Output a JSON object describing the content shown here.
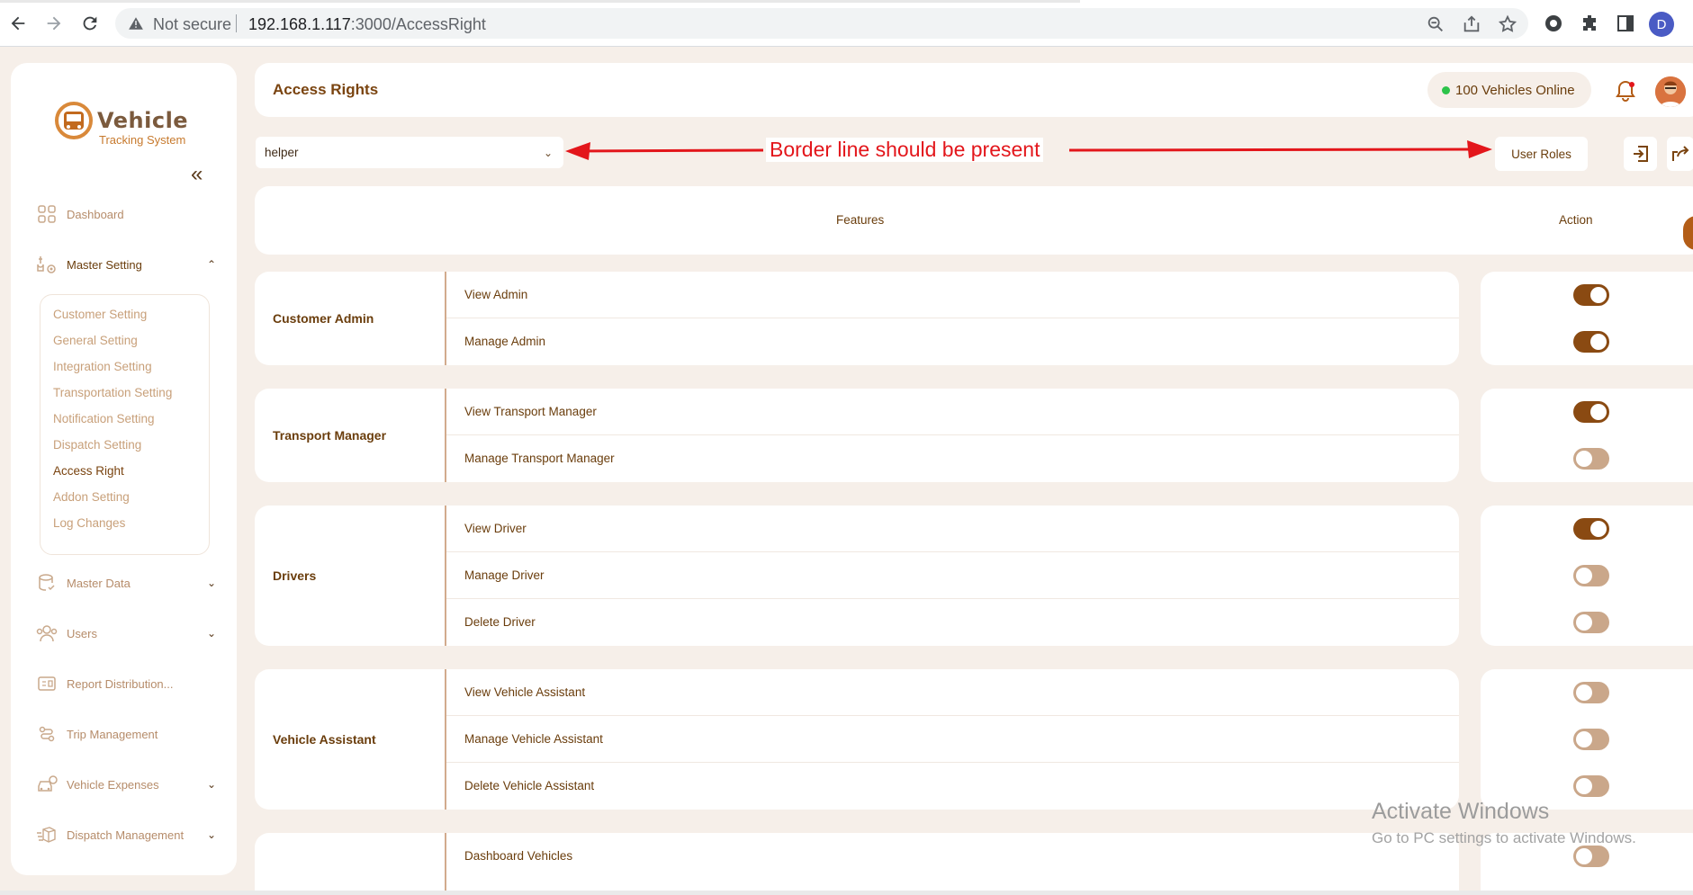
{
  "browser": {
    "security_label": "Not secure",
    "url_host": "192.168.1.117",
    "url_path": ":3000/AccessRight",
    "profile_initial": "D"
  },
  "sidebar": {
    "logo_title": "Vehicle",
    "logo_subtitle": "Tracking System",
    "items": [
      {
        "label": "Dashboard",
        "icon": "dashboard-icon"
      },
      {
        "label": "Master Setting",
        "icon": "settings-icon"
      },
      {
        "label": "Master Data",
        "icon": "database-icon"
      },
      {
        "label": "Users",
        "icon": "users-icon"
      },
      {
        "label": "Report Distribution...",
        "icon": "report-icon"
      },
      {
        "label": "Trip Management",
        "icon": "route-icon"
      },
      {
        "label": "Vehicle Expenses",
        "icon": "car-expense-icon"
      },
      {
        "label": "Dispatch Management",
        "icon": "dispatch-icon"
      }
    ],
    "submenu": [
      "Customer Setting",
      "General Setting",
      "Integration Setting",
      "Transportation Setting",
      "Notification Setting",
      "Dispatch Setting",
      "Access Right",
      "Addon Setting",
      "Log Changes"
    ],
    "active_submenu": "Access Right"
  },
  "header": {
    "title": "Access Rights",
    "online_label": "100 Vehicles Online"
  },
  "toolbar": {
    "role_value": "helper",
    "annotation": "Border line should be present",
    "user_roles_label": "User Roles"
  },
  "table": {
    "col_features": "Features",
    "col_action": "Action",
    "groups": [
      {
        "name": "Customer Admin",
        "features": [
          {
            "label": "View Admin",
            "enabled": true
          },
          {
            "label": "Manage Admin",
            "enabled": true
          }
        ]
      },
      {
        "name": "Transport Manager",
        "features": [
          {
            "label": "View Transport Manager",
            "enabled": true
          },
          {
            "label": "Manage Transport Manager",
            "enabled": false
          }
        ]
      },
      {
        "name": "Drivers",
        "features": [
          {
            "label": "View Driver",
            "enabled": true
          },
          {
            "label": "Manage Driver",
            "enabled": false
          },
          {
            "label": "Delete Driver",
            "enabled": false
          }
        ]
      },
      {
        "name": "Vehicle Assistant",
        "features": [
          {
            "label": "View Vehicle Assistant",
            "enabled": false
          },
          {
            "label": "Manage Vehicle Assistant",
            "enabled": false
          },
          {
            "label": "Delete Vehicle Assistant",
            "enabled": false
          }
        ]
      },
      {
        "name": "",
        "features": [
          {
            "label": "Dashboard Vehicles",
            "enabled": false
          }
        ]
      }
    ]
  },
  "watermark": {
    "line1": "Activate Windows",
    "line2": "Go to PC settings to activate Windows."
  },
  "colors": {
    "accent": "#8a4a12",
    "toggle_off": "#caa78a",
    "background": "#f6efe9",
    "annotation": "#e3161b"
  }
}
